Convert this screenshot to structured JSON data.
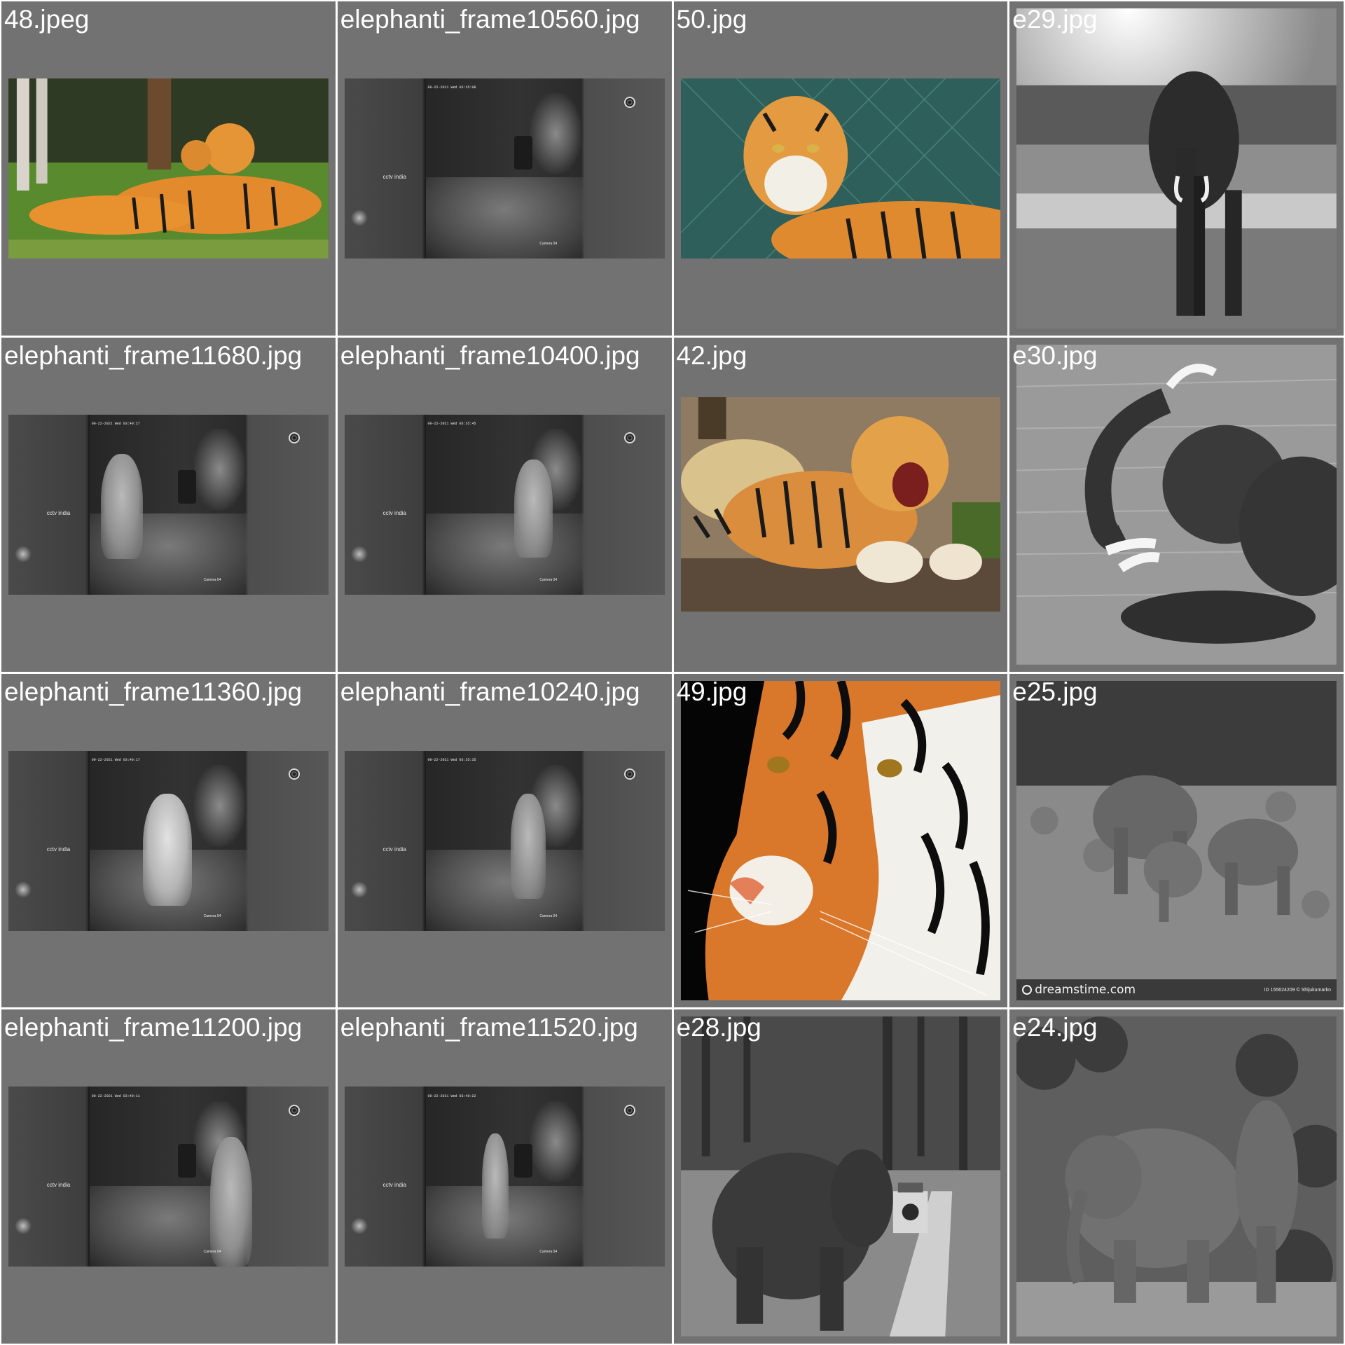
{
  "tiles": [
    {
      "label": "48.jpeg",
      "subject": "tiger-with-cub"
    },
    {
      "label": "elephanti_frame10560.jpg",
      "subject": "cctv-night-frame"
    },
    {
      "label": "50.jpg",
      "subject": "tiger-lying"
    },
    {
      "label": "e29.jpg",
      "subject": "elephant-grayscale"
    },
    {
      "label": "elephanti_frame11680.jpg",
      "subject": "cctv-night-frame"
    },
    {
      "label": "elephanti_frame10400.jpg",
      "subject": "cctv-night-frame"
    },
    {
      "label": "42.jpg",
      "subject": "tiger-snarling"
    },
    {
      "label": "e30.jpg",
      "subject": "elephant-spraying-water"
    },
    {
      "label": "elephanti_frame11360.jpg",
      "subject": "cctv-night-frame"
    },
    {
      "label": "elephanti_frame10240.jpg",
      "subject": "cctv-night-frame"
    },
    {
      "label": "49.jpg",
      "subject": "tiger-face-closeup"
    },
    {
      "label": "e25.jpg",
      "subject": "elephant-herd"
    },
    {
      "label": "elephanti_frame11200.jpg",
      "subject": "cctv-night-frame"
    },
    {
      "label": "elephanti_frame11520.jpg",
      "subject": "cctv-night-frame"
    },
    {
      "label": "e28.jpg",
      "subject": "elephant-and-jeep"
    },
    {
      "label": "e24.jpg",
      "subject": "two-elephants"
    }
  ],
  "cctv": {
    "caption": "cctv india",
    "camera_label": "Camera 04",
    "timestamps": {
      "frame10560": "09-22-2021 Wed 03:35:08",
      "frame11680": "09-22-2021 Wed 03:40:27",
      "frame10400": "09-22-2021 Wed 03:35:45",
      "frame11360": "09-22-2021 Wed 03:40:17",
      "frame10240": "09-22-2021 Wed 03:35:35",
      "frame11200": "09-22-2021 Wed 03:40:11",
      "frame11520": "09-22-2021 Wed 03:40:22"
    }
  },
  "watermark": {
    "brand": "dreamstime.com",
    "id_text": "ID 155624209 © Shijukumarkn"
  },
  "colors": {
    "tile_background": "#727272",
    "label_text": "#ffffff",
    "grid_gap": "#ffffff"
  }
}
